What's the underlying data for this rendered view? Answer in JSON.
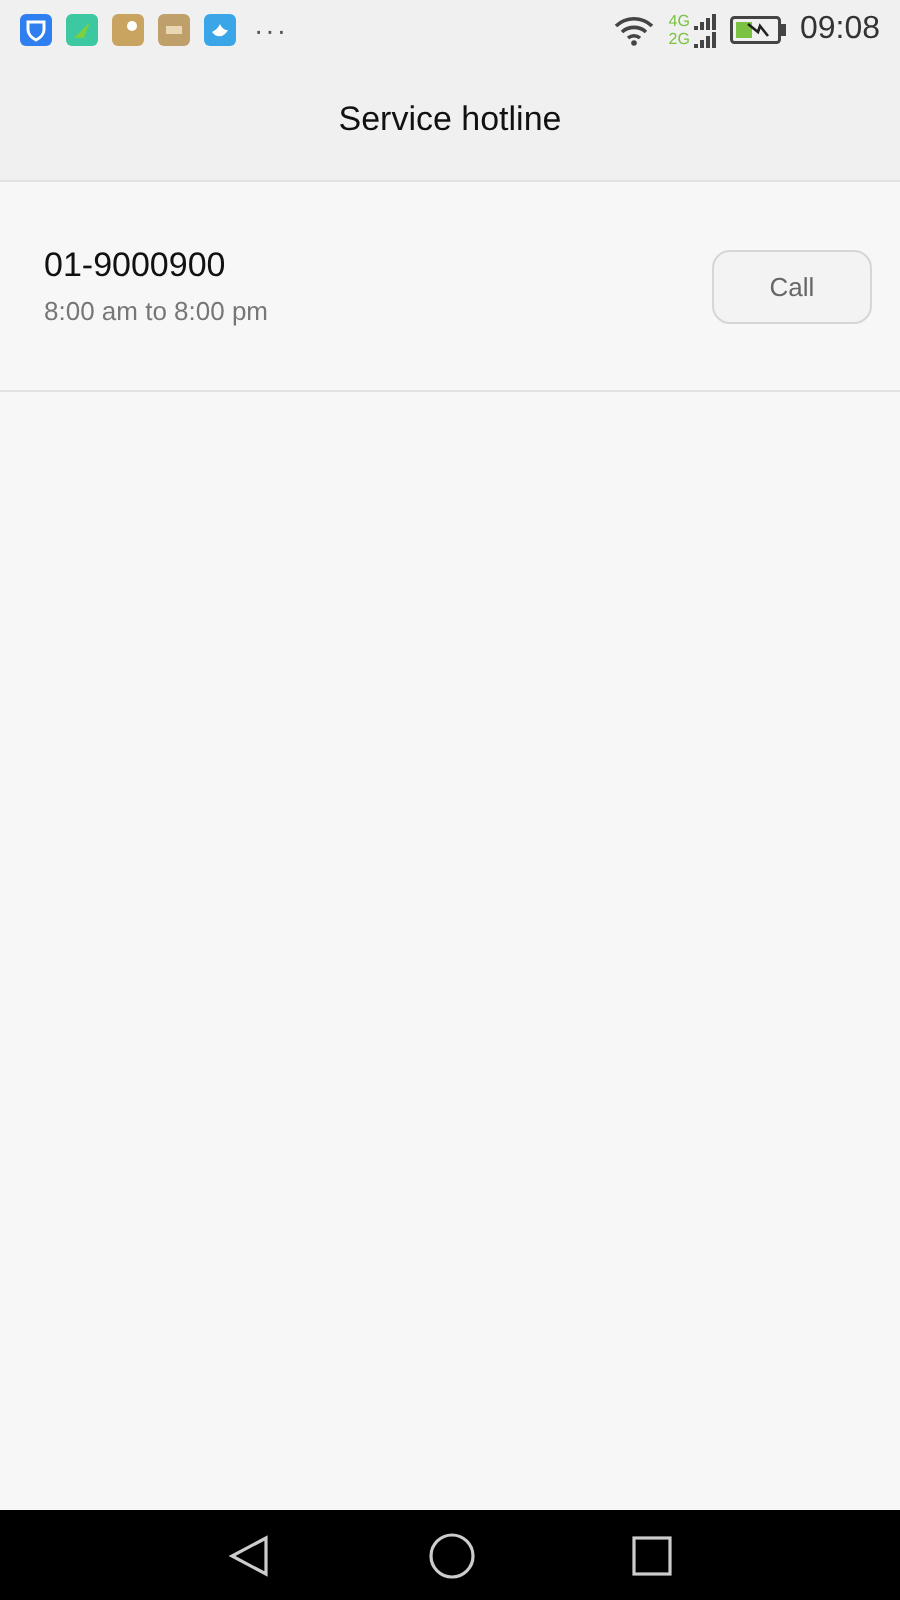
{
  "status_bar": {
    "overflow": "···",
    "networks": [
      "4G",
      "2G"
    ],
    "time": "09:08"
  },
  "header": {
    "title": "Service hotline"
  },
  "hotlines": [
    {
      "number": "01-9000900",
      "hours": "8:00 am to 8:00 pm",
      "action": "Call"
    }
  ]
}
